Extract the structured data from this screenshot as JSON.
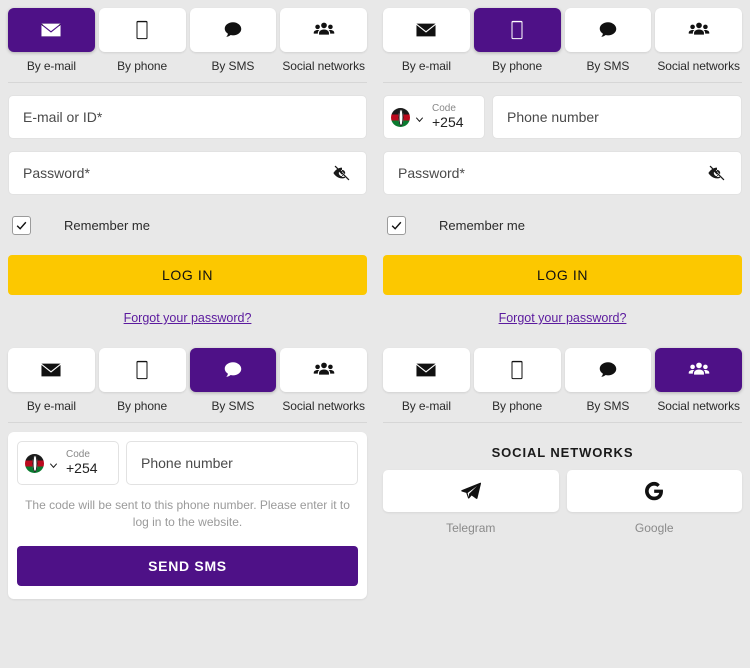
{
  "theme": {
    "purple": "#4e1187",
    "yellow": "#fcc800",
    "link": "#5b1a9e",
    "bg": "#e8e8e8"
  },
  "tabs": [
    {
      "label": "By e-mail",
      "icon": "envelope-icon"
    },
    {
      "label": "By phone",
      "icon": "mobile-phone-icon"
    },
    {
      "label": "By SMS",
      "icon": "speech-bubble-icon"
    },
    {
      "label": "Social networks",
      "icon": "people-group-icon"
    }
  ],
  "panels": {
    "email": {
      "active_tab": "By e-mail",
      "login_placeholder": "E-mail or ID*",
      "password_placeholder": "Password*",
      "password_toggle_icon": "eye-slash-icon",
      "remember_label": "Remember me",
      "remember_checked": true,
      "submit_label": "LOG IN",
      "forgot_label": "Forgot your password?"
    },
    "phone": {
      "active_tab": "By phone",
      "code_caption": "Code",
      "code_value": "+254",
      "country_flag": "kenya-flag-icon",
      "phone_placeholder": "Phone number",
      "password_placeholder": "Password*",
      "password_toggle_icon": "eye-slash-icon",
      "remember_label": "Remember me",
      "remember_checked": true,
      "submit_label": "LOG IN",
      "forgot_label": "Forgot your password?"
    },
    "sms": {
      "active_tab": "By SMS",
      "code_caption": "Code",
      "code_value": "+254",
      "country_flag": "kenya-flag-icon",
      "phone_placeholder": "Phone number",
      "note": "The code will be sent to this phone number. Please enter it to log in to the website.",
      "submit_label": "SEND SMS"
    },
    "social": {
      "active_tab": "Social networks",
      "title": "SOCIAL NETWORKS",
      "providers": [
        {
          "label": "Telegram",
          "icon": "telegram-paper-plane-icon"
        },
        {
          "label": "Google",
          "icon": "google-g-icon"
        }
      ]
    }
  }
}
